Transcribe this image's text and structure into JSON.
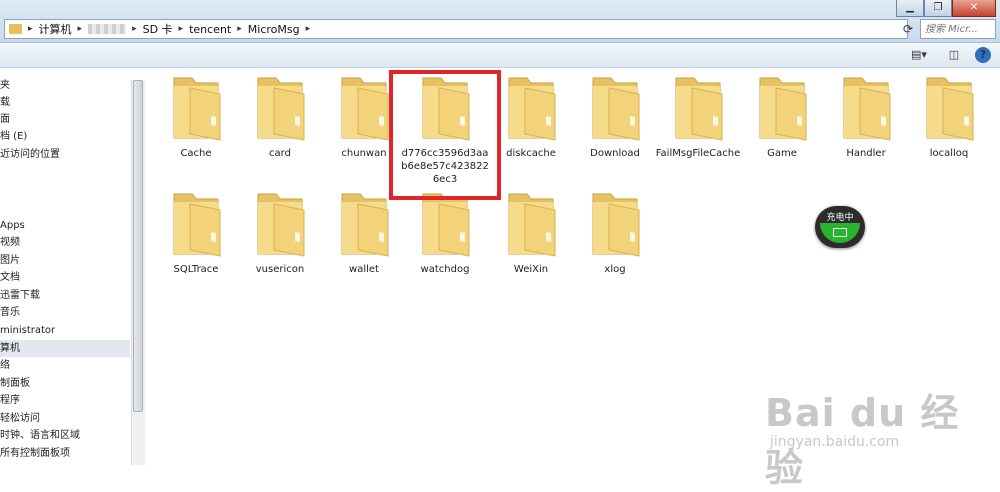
{
  "window": {
    "controls": {
      "minimize": "▁",
      "maximize": "❐",
      "close": "✕"
    }
  },
  "address": {
    "segments": [
      "计算机",
      "SD 卡",
      "tencent",
      "MicroMsg"
    ],
    "separator": "▸"
  },
  "search": {
    "placeholder": "搜索 Micr..."
  },
  "toolbar": {
    "view_icon": "▤▾",
    "pane_icon": "◫",
    "help_icon": "?"
  },
  "nav": {
    "items": [
      "夹",
      "载",
      "面",
      "档 (E)",
      "近访问的位置",
      "",
      "",
      "",
      "Apps",
      "视频",
      "图片",
      "文档",
      "迅雷下载",
      "音乐",
      "ministrator",
      "算机",
      "络",
      "制面板",
      "程序",
      "轻松访问",
      "时钟、语言和区域",
      "所有控制面板项"
    ]
  },
  "folders": [
    "Cache",
    "card",
    "chunwan",
    "d776cc3596d3aab6e8e57c4238226ec3",
    "diskcache",
    "Download",
    "FailMsgFileCache",
    "Game",
    "Handler",
    "localloq",
    "SQLTrace",
    "vusericon",
    "wallet",
    "watchdog",
    "WeiXin",
    "xlog"
  ],
  "charging": {
    "label": "充电中"
  },
  "watermark": {
    "brand": "Bai du 经验",
    "url": "jingyan.baidu.com"
  },
  "colors": {
    "highlight": "#e0262a",
    "folder": "#f2d27a",
    "selection": "#e4e8ee"
  }
}
